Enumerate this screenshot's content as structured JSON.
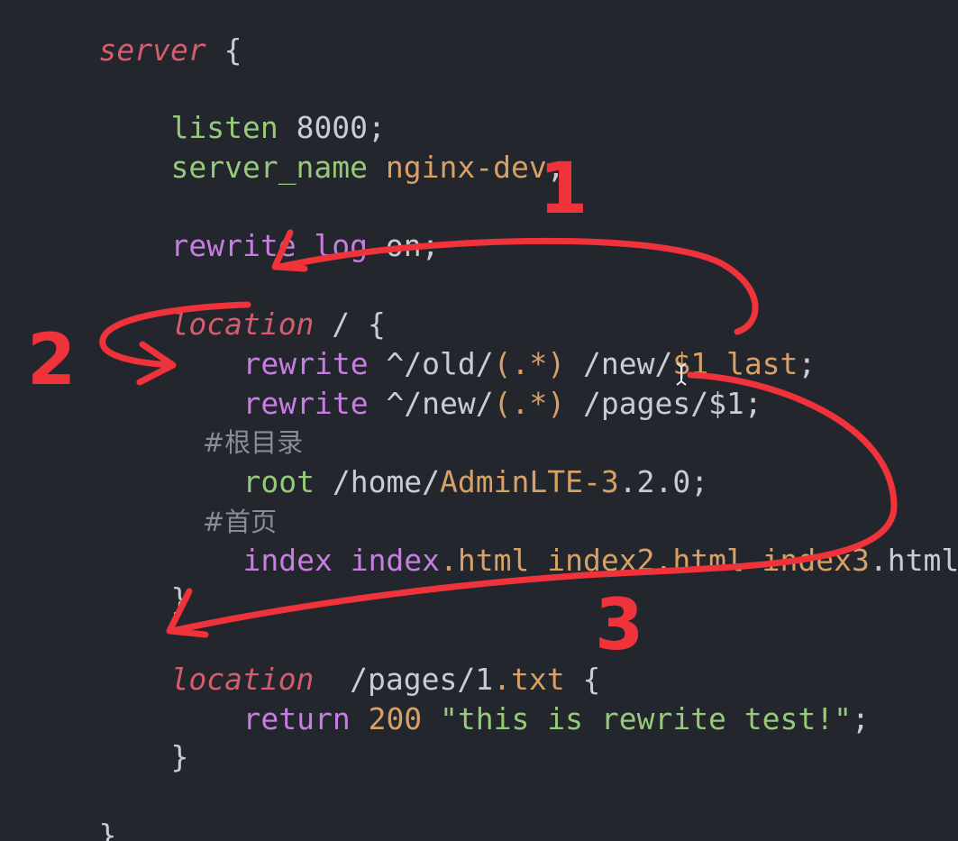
{
  "code": {
    "l0": {
      "kw": "server",
      "rest": " {"
    },
    "l2": {
      "kw": "listen",
      "rest": " 8000;"
    },
    "l3": {
      "kw": "server_name",
      "val": "nginx-dev",
      "rest": ";"
    },
    "l5": {
      "kw": "rewrite_log",
      "rest": " on;"
    },
    "l7": {
      "kw": "location",
      "rest": " / {"
    },
    "l8": {
      "kw": "rewrite",
      "a": " ^/old/",
      "b": "(.*)",
      "c": " /new/",
      "d": "$1 last",
      "e": ";"
    },
    "l9": {
      "kw": "rewrite",
      "a": " ^/new/",
      "b": "(.*)",
      "c": " /pages/$1;"
    },
    "l10": {
      "text": "#根目录"
    },
    "l11": {
      "kw": "root",
      "a": " /home/",
      "b": "AdminLTE-3",
      "c": ".2.0;"
    },
    "l12": {
      "text": "#首页"
    },
    "l13": {
      "kw": "index",
      "a": " index",
      "b": ".html",
      "c": " index2",
      "d": ".html",
      "e": " index3",
      "f": ".html;"
    },
    "l14": {
      "text": "}"
    },
    "l16": {
      "kw": "location",
      "a": "  /pages/1",
      "b": ".txt",
      "c": " {"
    },
    "l17": {
      "kw": "return",
      "a": " 200 ",
      "b": "\"this is rewrite test!\"",
      "c": ";"
    },
    "l18": {
      "text": "}"
    },
    "l20": {
      "text": "}"
    }
  },
  "annotations": {
    "n1": "1",
    "n2": "2",
    "n3": "3",
    "color": "#f0333a"
  },
  "colors": {
    "background": "#24262e",
    "keyword_red": "#d45d6e",
    "keyword_green": "#96c97a",
    "keyword_purple": "#c67ee0",
    "value_orange": "#d7a165",
    "plain": "#c9ccd3",
    "comment": "#8a8d96"
  }
}
